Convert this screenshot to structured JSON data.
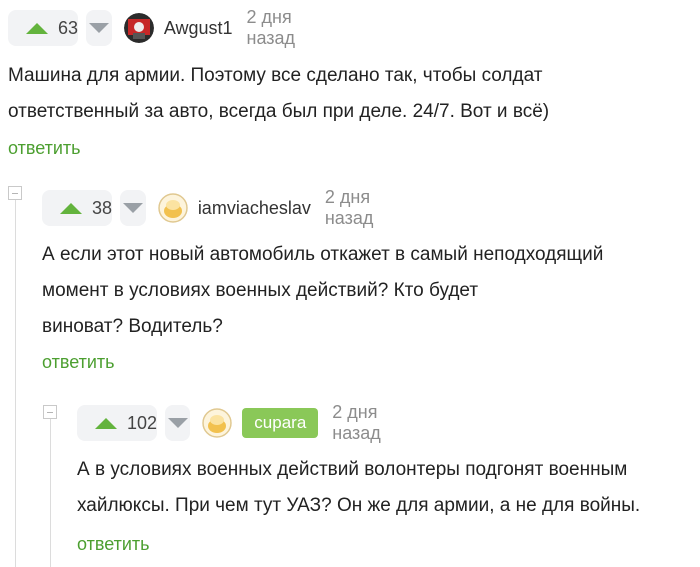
{
  "comments": [
    {
      "score": "63",
      "author": "Awgust1",
      "time": "2 дня назад",
      "lines": [
        "Машина для армии. Поэтому все сделано так, чтобы солдат",
        "ответственный за авто, всегда был при деле. 24/7. Вот и всё)"
      ],
      "reply": "ответить"
    },
    {
      "score": "38",
      "author": "iamviacheslav",
      "time": "2 дня назад",
      "lines": [
        "А если этот новый автомобиль откажет в самый неподходящий",
        "момент в условиях военных действий? Кто будет",
        "виноват? Водитель?"
      ],
      "reply": "ответить"
    },
    {
      "score": "102",
      "author": "cupara",
      "time": "2 дня назад",
      "lines": [
        "А в условиях военных действий волонтеры подгонят военным",
        "хайлюксы. При чем тут УАЗ? Он же для армии, а не для войны."
      ],
      "reply": "ответить"
    }
  ],
  "colors": {
    "accent": "#63b33d",
    "reply_link": "#4c9f30",
    "badge": "#8ac858"
  }
}
